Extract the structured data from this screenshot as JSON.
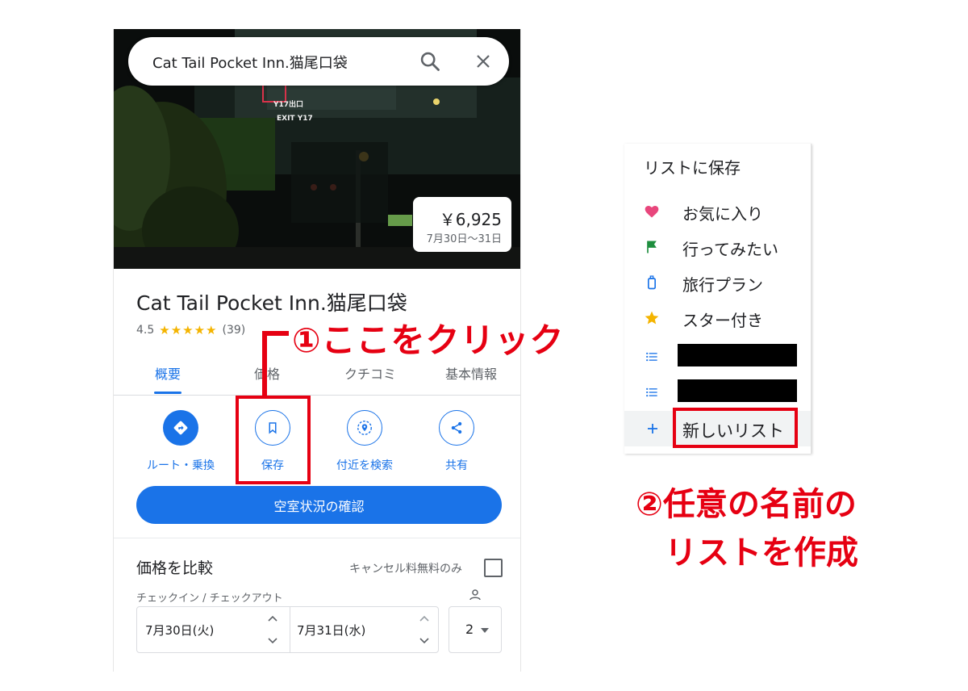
{
  "search": {
    "query": "Cat Tail Pocket Inn.猫尾口袋"
  },
  "hero": {
    "price": "￥6,925",
    "dates": "7月30日〜31日",
    "sign_exit_jp": "Y17出口",
    "sign_exit_en": "EXIT Y17"
  },
  "place": {
    "title": "Cat Tail Pocket Inn.猫尾口袋",
    "rating": "4.5",
    "stars": "★★★★★",
    "review_count": "(39)"
  },
  "tabs": [
    {
      "label": "概要",
      "active": true
    },
    {
      "label": "価格"
    },
    {
      "label": "クチコミ"
    },
    {
      "label": "基本情報"
    }
  ],
  "actions": [
    {
      "label": "ルート・乗換",
      "icon": "directions-icon"
    },
    {
      "label": "保存",
      "icon": "bookmark-icon"
    },
    {
      "label": "付近を検索",
      "icon": "nearby-icon"
    },
    {
      "label": "共有",
      "icon": "share-icon"
    }
  ],
  "availability_button": "空室状況の確認",
  "compare": {
    "title": "価格を比較",
    "cancel_label": "キャンセル料無料のみ",
    "checkin_label": "チェックイン / チェックアウト",
    "checkin": "7月30日(火)",
    "checkout": "7月31日(水)",
    "guests": "2"
  },
  "annotations": {
    "step1": "①ここをクリック",
    "step2_line1": "②任意の名前の",
    "step2_line2": "リストを作成"
  },
  "save_popup": {
    "title": "リストに保存",
    "items": [
      {
        "label": "お気に入り",
        "icon": "heart-icon",
        "color": "#e8467c"
      },
      {
        "label": "行ってみたい",
        "icon": "flag-icon",
        "color": "#1e8e3e"
      },
      {
        "label": "旅行プラン",
        "icon": "luggage-icon",
        "color": "#1a73e8"
      },
      {
        "label": "スター付き",
        "icon": "star-icon",
        "color": "#f4b400"
      }
    ],
    "new_list": "新しいリスト"
  },
  "colors": {
    "accent": "#1a73e8",
    "annotation_red": "#e60012"
  }
}
